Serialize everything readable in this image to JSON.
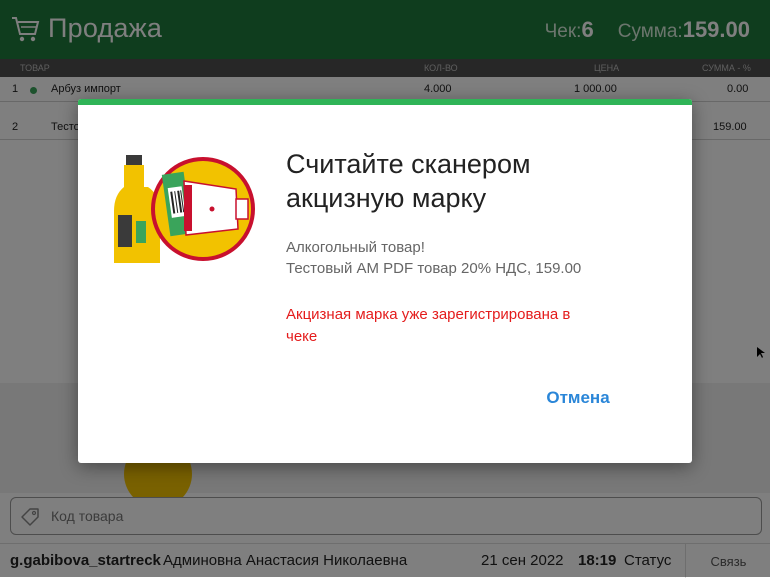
{
  "header": {
    "title": "Продажа",
    "check_label": "Чек:",
    "check_number": "6",
    "sum_label": "Сумма:",
    "sum_value": "159.00"
  },
  "table": {
    "columns": [
      "ТОВАР",
      "КОЛ-ВО",
      "ЦЕНА",
      "СУММА - %"
    ],
    "rows": [
      {
        "index": "1",
        "name": "Арбуз импорт",
        "qty": "4.000",
        "price": "1 000.00",
        "sum": "0.00"
      },
      {
        "index": "2",
        "name": "Тесто",
        "qty": "",
        "price": "",
        "sum": "159.00"
      }
    ]
  },
  "code_input": {
    "placeholder": "Код товара"
  },
  "status_bar": {
    "login": "g.gabibova_startreck",
    "user_name": "Админовна Анастасия Николаевна",
    "date": "21 сен 2022",
    "time": "18:19",
    "status_label": "Статус",
    "link_label": "Связь"
  },
  "dialog": {
    "title_line1": "Считайте сканером",
    "title_line2": "акцизную марку",
    "desc_line1": "Алкогольный товар!",
    "desc_line2": "Тестовый АМ PDF товар 20% НДС, 159.00",
    "error_line1": "Акцизная марка уже зарегистрирована в",
    "error_line2": "чеке",
    "cancel_label": "Отмена"
  },
  "colors": {
    "header_bg": "#1f7b3c",
    "dialog_accent": "#2fb457",
    "error": "#e41c1c",
    "link": "#2a86d8",
    "illustration_yellow": "#f2c200",
    "illustration_red": "#c8102e"
  }
}
